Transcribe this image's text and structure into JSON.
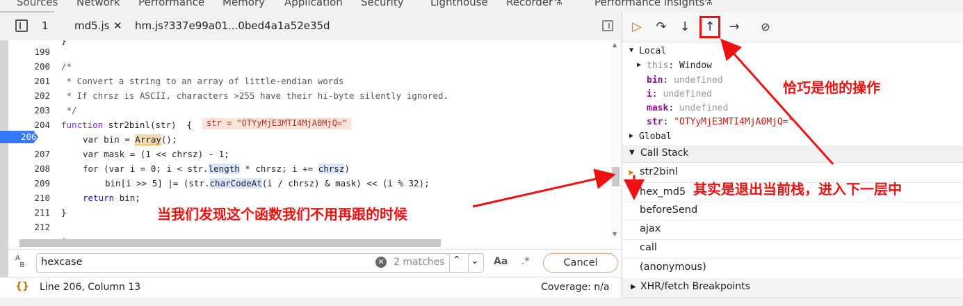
{
  "top_tabs": [
    "Sources",
    "Network",
    "Performance",
    "Memory",
    "Application",
    "Security",
    "Lighthouse",
    "Recorder",
    "Performance insights"
  ],
  "file_tabs": {
    "count": "1",
    "tab1": "md5.js",
    "tab2": "hm.js?337e99a01...0bed4a1a52e35d"
  },
  "code": {
    "line_numbers": [
      "199",
      "200",
      "201",
      "202",
      "203",
      "204",
      "206",
      "207",
      "208",
      "209",
      "210",
      "211",
      "212"
    ],
    "l200": "/*",
    "l201": " * Convert a string to an array of little-endian words",
    "l202": " * If chrsz is ASCII, characters >255 have their hi-byte silently ignored.",
    "l203": " */",
    "l204_kw": "function",
    "l204_rest": " str2binl(str)  {",
    "l204_inline": "str = \"OTYyMjE3MTI4MjA0MjQ=\"",
    "l206_a": "var bin = ",
    "l206_b": "Array",
    "l206_c": "();",
    "l207": "var mask = (1 << chrsz) - 1;",
    "l208_a": "for (var i = 0; i < str.",
    "l208_b": "length",
    "l208_c": " * chrsz; i += ",
    "l208_d": "chrsz",
    "l208_e": ")",
    "l209_a": "bin[i >> 5] |= (str.",
    "l209_b": "charCodeAt",
    "l209_c": "(i / chrsz) & mask) << (i % 32);",
    "l210_kw": "return",
    "l210_rest": " bin;",
    "l211": "}"
  },
  "search": {
    "value": "hexcase",
    "matches": "2 matches",
    "case_label": "Aa",
    "regex_label": ".*",
    "cancel": "Cancel"
  },
  "status": {
    "position": "Line 206, Column 13",
    "coverage": "Coverage: n/a"
  },
  "scope": {
    "local": "Local",
    "this_name": "this",
    "this_val": "Window",
    "bin": "bin",
    "i": "i",
    "mask": "mask",
    "str": "str",
    "undefined": "undefined",
    "str_val": "\"OTYyMjE3MTI4MjA0MjQ=\"",
    "global": "Global"
  },
  "call_stack": {
    "title": "Call Stack",
    "frames": [
      "str2binl",
      "hex_md5",
      "beforeSend",
      "ajax",
      "call",
      "(anonymous)"
    ]
  },
  "xhr": "XHR/fetch Breakpoints",
  "annotations": {
    "a1": "恰巧是他的操作",
    "a2": "其实是退出当前栈，进入下一层中",
    "a3": "当我们发现这个函数我们不用再跟的时候"
  },
  "colors": {
    "accent": "#3478f6",
    "annotation": "#ee1111",
    "exec_line": "#fffbe0"
  }
}
